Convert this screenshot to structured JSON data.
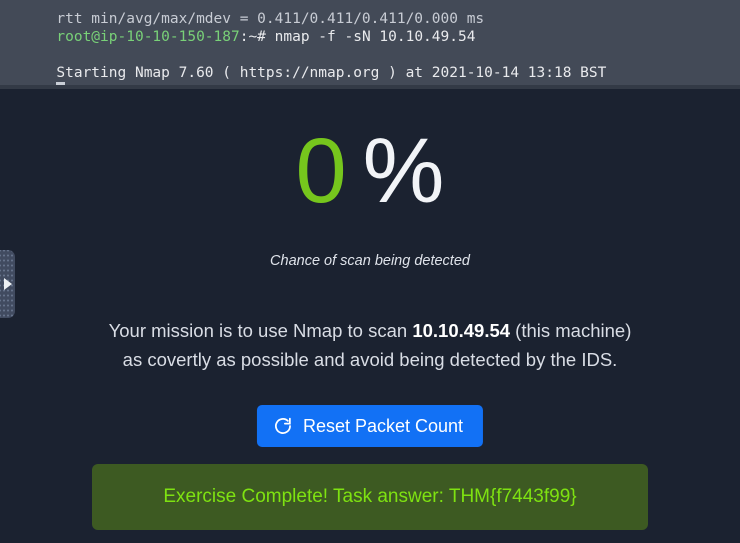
{
  "terminal": {
    "lines": [
      {
        "type": "plain",
        "text": "rtt min/avg/max/mdev = 0.411/0.411/0.411/0.000 ms"
      },
      {
        "type": "prompt",
        "user_host": "root@ip-10-10-150-187",
        "path_sign": ":~# ",
        "command": "nmap -f -sN 10.10.49.54"
      },
      {
        "type": "blank",
        "text": ""
      },
      {
        "type": "plain",
        "text": "Starting Nmap 7.60 ( https://nmap.org ) at 2021-10-14 13:18 BST"
      }
    ],
    "cursor": "block-cursor",
    "prompt_color": "#79d178",
    "background": "#434a57"
  },
  "scan_meter": {
    "value": "0",
    "unit": "%",
    "caption": "Chance of scan being detected",
    "value_color": "#76c61d",
    "unit_color": "#f2f4f7"
  },
  "mission": {
    "line1_prefix": "Your mission is to use Nmap to scan ",
    "target_ip": "10.10.49.54",
    "line1_suffix": " (this machine)",
    "line2": "as covertly as possible and avoid being detected by the IDS."
  },
  "reset_button": {
    "label": "Reset Packet Count",
    "icon": "refresh-icon",
    "color": "#1271f5"
  },
  "completion_banner": {
    "text": "Exercise Complete! Task answer: THM{f7443f99}",
    "flag": "THM{f7443f99}",
    "background": "#3d5a22",
    "text_color": "#7ee211"
  },
  "drag_handle": {
    "icon": "expand-right-arrow-icon",
    "grip": "dot-grid"
  }
}
